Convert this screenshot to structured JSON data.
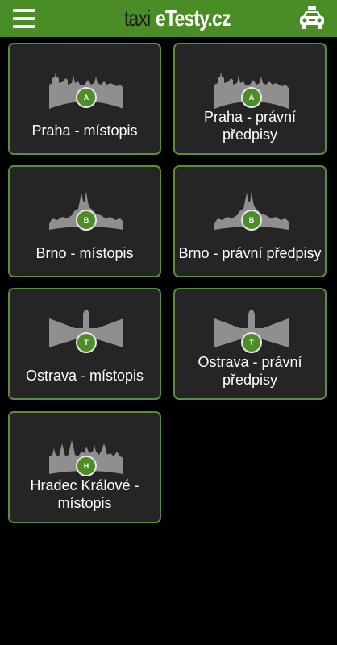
{
  "header": {
    "logo_left": "taxi",
    "logo_right": "eTesty.cz",
    "menu_icon": "hamburger-menu-icon",
    "taxi_icon": "taxi-car-icon"
  },
  "colors": {
    "header_bg": "#4a8c25",
    "tile_bg": "#252525",
    "tile_border": "#5c8b3e",
    "badge_bg": "#4e8c27",
    "silhouette": "#8f8f8f"
  },
  "tiles": [
    {
      "label": "Praha - místopis",
      "badge": "A",
      "icon": "prague-castle-silhouette-icon"
    },
    {
      "label": "Praha - právní předpisy",
      "badge": "A",
      "icon": "prague-castle-silhouette-icon"
    },
    {
      "label": "Brno - místopis",
      "badge": "B",
      "icon": "brno-cathedral-silhouette-icon"
    },
    {
      "label": "Brno - právní předpisy",
      "badge": "B",
      "icon": "brno-cathedral-silhouette-icon"
    },
    {
      "label": "Ostrava - místopis",
      "badge": "T",
      "icon": "ostrava-city-hall-silhouette-icon"
    },
    {
      "label": "Ostrava - právní předpisy",
      "badge": "T",
      "icon": "ostrava-city-hall-silhouette-icon"
    },
    {
      "label": "Hradec Králové - místopis",
      "badge": "H",
      "icon": "hradec-kralove-silhouette-icon"
    }
  ]
}
